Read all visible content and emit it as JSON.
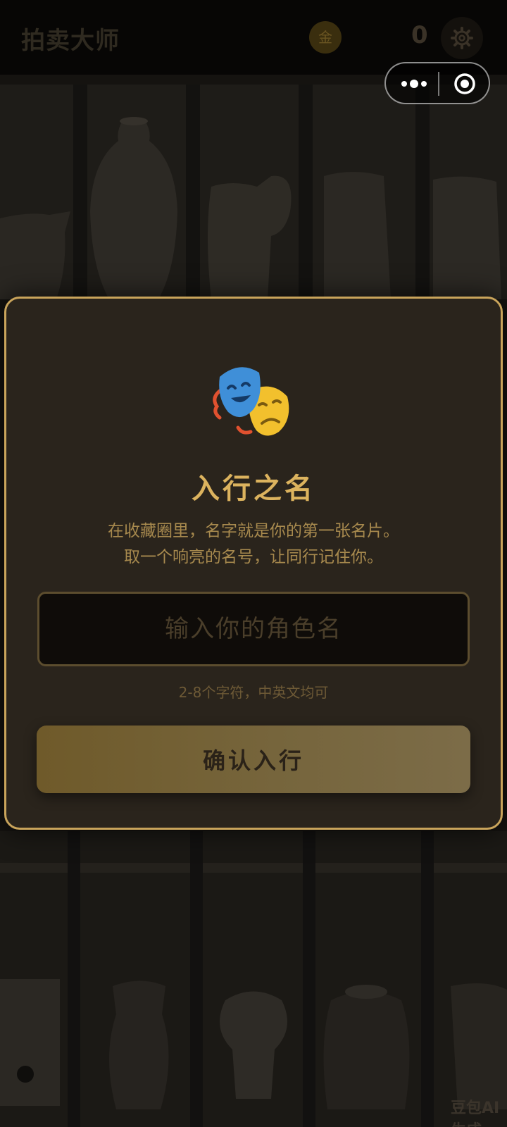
{
  "header": {
    "app_title": "拍卖大师",
    "coin_badge_label": "金",
    "coin_count": "0",
    "settings_icon": "gear-icon"
  },
  "capsule": {
    "more_icon": "more-dots-icon",
    "close_icon": "close-target-icon"
  },
  "dialog": {
    "icon": "theater-masks-icon",
    "title": "入行之名",
    "subtitle_line1": "在收藏圈里，名字就是你的第一张名片。",
    "subtitle_line2": "取一个响亮的名号，让同行记住你。",
    "name_input": {
      "placeholder": "输入你的角色名",
      "value": ""
    },
    "hint": "2-8个字符，中英文均可",
    "confirm_label": "确认入行"
  },
  "watermark": "豆包AI生成",
  "colors": {
    "accent_gold": "#dcb35e",
    "modal_border": "#c9a45b",
    "modal_bg": "#2a241c",
    "button_gold": "#76653c",
    "topbar_bg": "#070605"
  }
}
